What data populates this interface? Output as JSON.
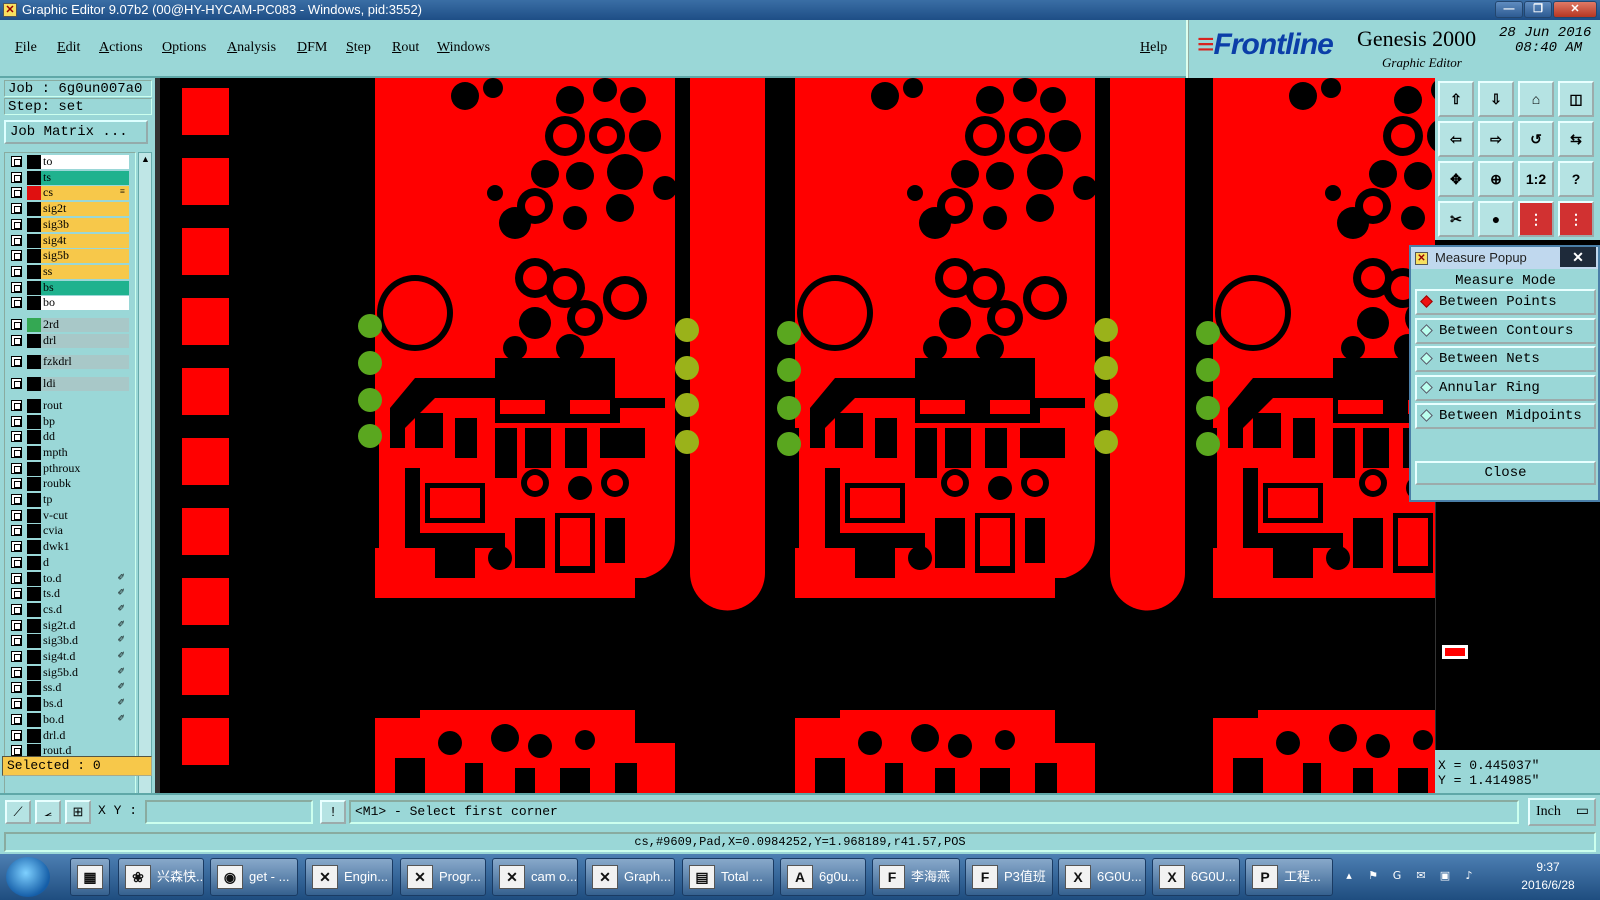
{
  "window": {
    "title": "Graphic Editor 9.07b2 (00@HY-HYCAM-PC083 - Windows, pid:3552)",
    "min_glyph": "—",
    "max_glyph": "❐",
    "close_glyph": "✕"
  },
  "menu": [
    "File",
    "Edit",
    "Actions",
    "Options",
    "Analysis",
    "DFM",
    "Step",
    "Rout",
    "Windows"
  ],
  "help": "Help",
  "logo": {
    "brand": "Frontline",
    "product": "Genesis 2000",
    "subtitle": "Graphic Editor",
    "date": "28 Jun 2016",
    "time": "08:40 AM"
  },
  "job": {
    "job_line": "Job : 6g0un007a0",
    "step_line": "Step: set",
    "job_matrix": "Job Matrix ..."
  },
  "colors": {
    "board_copper": "#ff0000",
    "panel_bg": "#9ad7d7",
    "swatch_green": "#34a853",
    "swatch_red": "#e01010",
    "row_white": "#ffffff",
    "row_teal": "#1fb28e",
    "row_orange": "#f7c84a",
    "row_gray": "#a8c8c8",
    "row_light": "#9ad7d7"
  },
  "layers": [
    {
      "name": "to",
      "row": "row_white"
    },
    {
      "name": "ts",
      "row": "row_teal"
    },
    {
      "name": "cs",
      "row": "row_orange",
      "swatch": "swatch_red",
      "mark": "≡",
      "active": true
    },
    {
      "name": "sig2t",
      "row": "row_orange"
    },
    {
      "name": "sig3b",
      "row": "row_orange"
    },
    {
      "name": "sig4t",
      "row": "row_orange"
    },
    {
      "name": "sig5b",
      "row": "row_orange"
    },
    {
      "name": "ss",
      "row": "row_orange"
    },
    {
      "name": "bs",
      "row": "row_teal"
    },
    {
      "name": "bo",
      "row": "row_white"
    },
    {
      "name": "2rd",
      "row": "row_gray",
      "swatch": "swatch_green"
    },
    {
      "name": "drl",
      "row": "row_gray"
    },
    {
      "name": "fzkdrl",
      "row": "row_gray"
    },
    {
      "name": "ldi",
      "row": "row_gray"
    },
    {
      "name": "rout",
      "row": "row_light"
    },
    {
      "name": "bp",
      "row": "row_light"
    },
    {
      "name": "dd",
      "row": "row_light"
    },
    {
      "name": "mpth",
      "row": "row_light"
    },
    {
      "name": "pthroux",
      "row": "row_light"
    },
    {
      "name": "roubk",
      "row": "row_light"
    },
    {
      "name": "tp",
      "row": "row_light"
    },
    {
      "name": "v-cut",
      "row": "row_light"
    },
    {
      "name": "cvia",
      "row": "row_light"
    },
    {
      "name": "dwk1",
      "row": "row_light"
    },
    {
      "name": "d",
      "row": "row_light"
    },
    {
      "name": "to.d",
      "row": "row_light",
      "mark": "✐"
    },
    {
      "name": "ts.d",
      "row": "row_light",
      "mark": "✐"
    },
    {
      "name": "cs.d",
      "row": "row_light",
      "mark": "✐"
    },
    {
      "name": "sig2t.d",
      "row": "row_light",
      "mark": "✐"
    },
    {
      "name": "sig3b.d",
      "row": "row_light",
      "mark": "✐"
    },
    {
      "name": "sig4t.d",
      "row": "row_light",
      "mark": "✐"
    },
    {
      "name": "sig5b.d",
      "row": "row_light",
      "mark": "✐"
    },
    {
      "name": "ss.d",
      "row": "row_light",
      "mark": "✐"
    },
    {
      "name": "bs.d",
      "row": "row_light",
      "mark": "✐"
    },
    {
      "name": "bo.d",
      "row": "row_light",
      "mark": "✐"
    },
    {
      "name": "drl.d",
      "row": "row_light"
    },
    {
      "name": "rout.d",
      "row": "row_light"
    }
  ],
  "selected": "Selected : 0",
  "tool_buttons": [
    "⇧",
    "⇩",
    "⌂",
    "◫",
    "⇦",
    "⇨",
    "↺",
    "⇆",
    "✥",
    "⊕",
    "1:2",
    "?",
    "✂",
    "●",
    "⋮",
    "⋮"
  ],
  "measure": {
    "title": "Measure Popup",
    "close_x": "✕",
    "mode_title": "Measure Mode",
    "options": [
      "Between Points",
      "Between Contours",
      "Between Nets",
      "Annular Ring",
      "Between Midpoints"
    ],
    "active_index": 0,
    "close_label": "Close"
  },
  "coords": {
    "x": "X = 0.445037\"",
    "y": "Y = 1.414985\""
  },
  "cmd": {
    "xy_label": "X Y :",
    "xy_value": "",
    "info_glyph": "!",
    "prompt": "<M1> - Select first corner",
    "units": "Inch",
    "units_glyph": "▭"
  },
  "status": "cs,#9609,Pad,X=0.0984252,Y=1.968189,r41.57,POS",
  "taskbar": {
    "items": [
      {
        "label": "",
        "icon": "▦"
      },
      {
        "label": "兴森快...",
        "icon": "❀"
      },
      {
        "label": "get - ...",
        "icon": "◉"
      },
      {
        "label": "Engin...",
        "icon": "✕"
      },
      {
        "label": "Progr...",
        "icon": "✕"
      },
      {
        "label": "cam o...",
        "icon": "✕"
      },
      {
        "label": "Graph...",
        "icon": "✕"
      },
      {
        "label": "Total ...",
        "icon": "▤"
      },
      {
        "label": "6g0u...",
        "icon": "A"
      },
      {
        "label": "李海燕",
        "icon": "F"
      },
      {
        "label": "P3值班",
        "icon": "F"
      },
      {
        "label": "6G0U...",
        "icon": "X"
      },
      {
        "label": "6G0U...",
        "icon": "X"
      },
      {
        "label": "工程...",
        "icon": "P"
      }
    ],
    "tray": [
      "▴",
      "⚑",
      "G",
      "✉",
      "▣",
      "♪"
    ],
    "time": "9:37",
    "date": "2016/6/28"
  }
}
